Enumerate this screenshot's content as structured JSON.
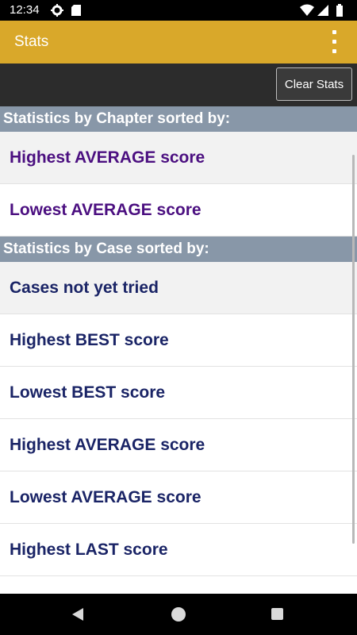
{
  "status_bar": {
    "time": "12:34",
    "left_icons": [
      "gear-icon",
      "sd-card-icon"
    ],
    "right_icons": [
      "wifi-icon",
      "signal-icon",
      "battery-icon"
    ]
  },
  "app_bar": {
    "title": "Stats",
    "overflow_icon": "more-vert-icon",
    "color": "#d9a82a"
  },
  "toolbar": {
    "clear_label": "Clear Stats"
  },
  "sections": [
    {
      "header": "Statistics by Chapter sorted by:",
      "items": [
        "Highest AVERAGE score",
        "Lowest AVERAGE score"
      ]
    },
    {
      "header": "Statistics by Case sorted by:",
      "items": [
        "Cases not yet tried",
        "Highest BEST score",
        "Lowest BEST score",
        "Highest AVERAGE score",
        "Lowest AVERAGE score",
        "Highest LAST score"
      ]
    }
  ],
  "nav_bar": {
    "icons": [
      "back-icon",
      "home-icon",
      "recents-icon"
    ]
  }
}
